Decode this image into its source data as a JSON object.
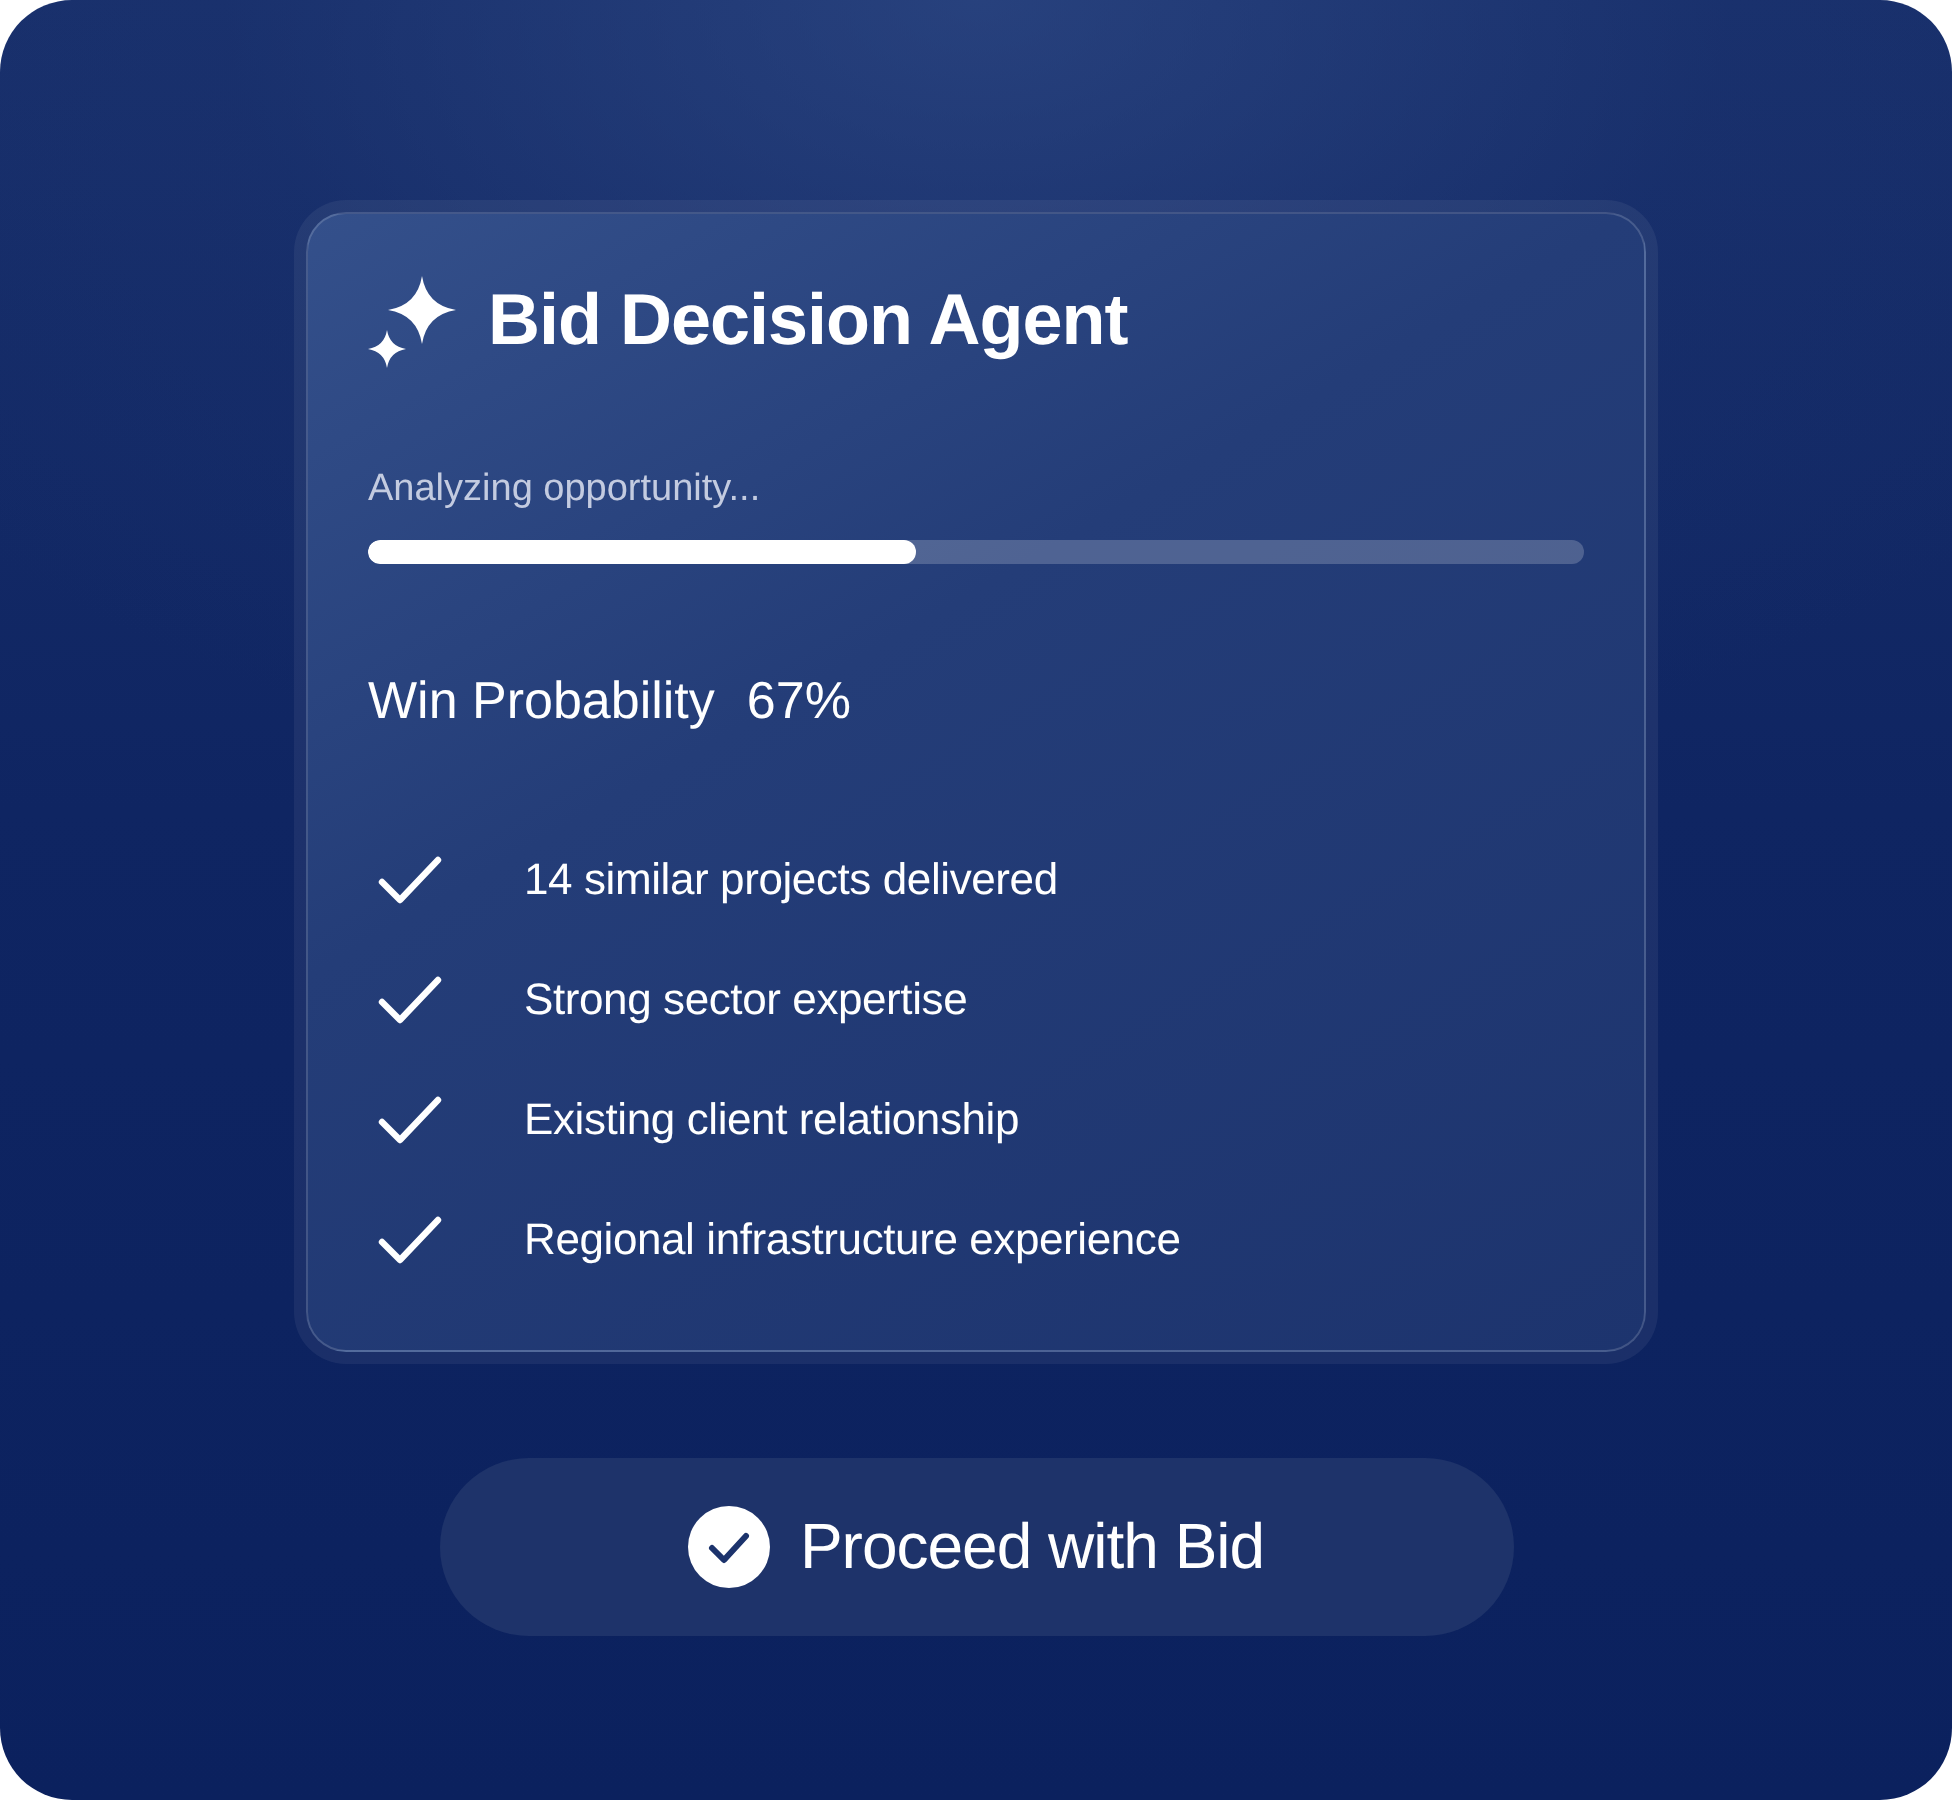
{
  "card": {
    "title": "Bid Decision Agent",
    "status": "Analyzing opportunity...",
    "progress": {
      "level": 0.45
    },
    "win_probability": {
      "label": "Win Probability",
      "value": "67%"
    },
    "factors": [
      {
        "text": "14 similar projects delivered",
        "checked": true
      },
      {
        "text": "Strong sector expertise",
        "checked": true
      },
      {
        "text": "Existing client relationship",
        "checked": true
      },
      {
        "text": "Regional infrastructure experience",
        "checked": true
      }
    ]
  },
  "action_button": {
    "label": "Proceed with Bid"
  }
}
